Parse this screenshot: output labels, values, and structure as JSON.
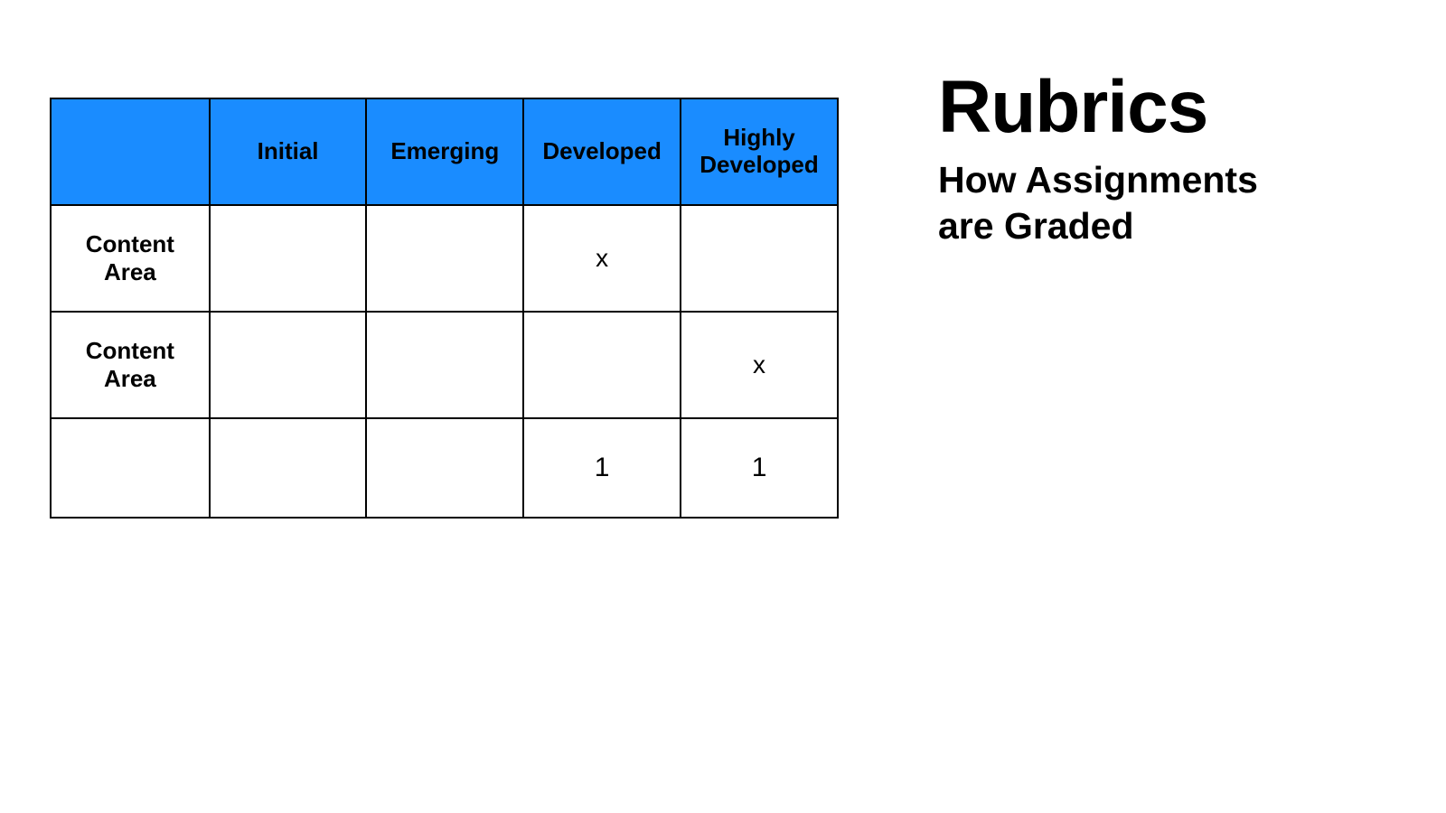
{
  "title": {
    "main": "Rubrics",
    "sub_line1": "How Assignments",
    "sub_line2": "are Graded"
  },
  "table": {
    "headers": {
      "blank": "",
      "initial": "Initial",
      "emerging": "Emerging",
      "developed": "Developed",
      "highly_line1": "Highly",
      "highly_line2": "Developed"
    },
    "rows": [
      {
        "label": "Content Area",
        "initial": "",
        "emerging": "",
        "developed": "x",
        "highly": ""
      },
      {
        "label": "Content Area",
        "initial": "",
        "emerging": "",
        "developed": "",
        "highly": "x"
      }
    ],
    "totals": {
      "label": "",
      "initial": "",
      "emerging": "",
      "developed": "1",
      "highly": "1"
    }
  },
  "chart_data": {
    "type": "table",
    "title": "Rubrics — How Assignments are Graded",
    "columns": [
      "",
      "Initial",
      "Emerging",
      "Developed",
      "Highly Developed"
    ],
    "rows": [
      [
        "Content Area",
        "",
        "",
        "x",
        ""
      ],
      [
        "Content Area",
        "",
        "",
        "",
        "x"
      ],
      [
        "",
        "",
        "",
        "1",
        "1"
      ]
    ]
  }
}
